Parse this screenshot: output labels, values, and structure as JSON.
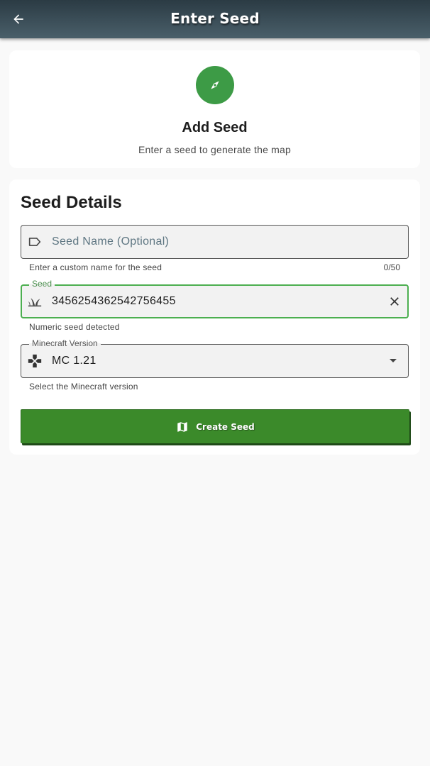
{
  "appbar": {
    "title": "Enter Seed",
    "back_icon": "arrow-back-icon"
  },
  "header_card": {
    "icon": "compass-icon",
    "title": "Add Seed",
    "subtitle": "Enter a seed to generate the map"
  },
  "details": {
    "title": "Seed Details",
    "seed_name": {
      "placeholder": "Seed Name (Optional)",
      "value": "",
      "helper": "Enter a custom name for the seed",
      "counter": "0/50",
      "icon": "label-icon"
    },
    "seed": {
      "label": "Seed",
      "value": "3456254362542756455",
      "helper": "Numeric seed detected",
      "icon": "grass-icon",
      "clear_icon": "close-icon"
    },
    "version": {
      "label": "Minecraft Version",
      "value": "MC 1.21",
      "helper": "Select the Minecraft version",
      "icon": "gamepad-icon"
    },
    "create_button": {
      "label": "Create Seed",
      "icon": "map-icon"
    }
  },
  "colors": {
    "accent": "#3d9b46",
    "button": "#3b8a2a",
    "focus": "#4caf50"
  }
}
